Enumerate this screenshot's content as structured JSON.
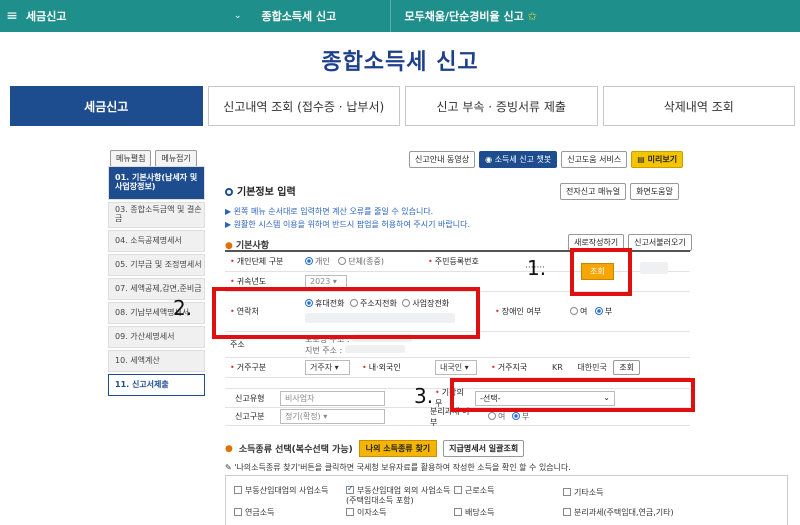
{
  "topnav": {
    "crumb1": "세금신고",
    "crumb2": "종합소득세 신고",
    "crumb3": "모두채움/단순경비율 신고"
  },
  "title": "종합소득세 신고",
  "tabs": [
    "세금신고",
    "신고내역 조회 (접수증 · 납부서)",
    "신고 부속 · 증빙서류 제출",
    "삭제내역 조회"
  ],
  "sidebar": {
    "expand": "메뉴펼침",
    "collapse": "메뉴접기",
    "items": [
      "01. 기본사항(납세자 및 사업장정보)",
      "03. 종합소득금액 및 결손금",
      "04. 소득공제명세서",
      "05. 기부금 및 조정명세서",
      "07. 세액공제,감면,준비금",
      "08. 기납부세액명세서",
      "09. 가산세명세서",
      "10. 세액계산",
      "11. 신고서제출"
    ]
  },
  "toolbar": {
    "video": "신고안내 동영상",
    "chatbot": "소득세 신고 챗봇",
    "help": "신고도움 서비스",
    "preview": "미리보기"
  },
  "section": {
    "title": "기본정보 입력",
    "manual": "전자신고 매뉴얼",
    "screen_help": "화면도움말",
    "note1": "▶ 왼쪽 메뉴 순서대로 입력하면 계산 오류를 줄일 수 있습니다.",
    "note2": "▶ 원활한 시스템 이용을 위하여 반드시 팝업을 허용하여 주시기 바랍니다."
  },
  "basic": {
    "title": "기본사항",
    "new_btn": "새로작성하기",
    "load_btn": "신고서불러오기",
    "type_label": "개인단체 구분",
    "type_opt1": "개인",
    "type_opt2": "단체(종중)",
    "rrn_label": "주민등록번호",
    "rrn_value": "·······",
    "lookup": "조회",
    "year_label": "귀속년도",
    "year_value": "2023",
    "contact_label": "연락처",
    "contact_opt1": "휴대전화",
    "contact_opt2": "주소지전화",
    "contact_opt3": "사업장전화",
    "disabled_label": "장애인 여부",
    "disabled_yes": "여",
    "disabled_no": "부",
    "address_label": "주소",
    "address_road": "도로명 주소 :",
    "address_lot": "지번 주소 :",
    "resident_label": "거주구분",
    "resident_value": "거주자",
    "nation_label": "내·외국인",
    "nation_value": "내국인",
    "region_label": "거주지국",
    "region_code": "KR",
    "region_name": "대한민국",
    "region_btn": "조회",
    "filing_type_label": "신고유형",
    "filing_type_value": "비사업자",
    "bookkeeping_label": "기장의무",
    "bookkeeping_value": "-선택-",
    "filing_class_label": "신고구분",
    "filing_class_value": "정기(확정)",
    "separate_label": "분리과세 여부",
    "separate_yes": "여",
    "separate_no": "부"
  },
  "annotations": [
    "1.",
    "2.",
    "3."
  ],
  "income": {
    "title": "소득종류 선택(복수선택 가능)",
    "find_btn": "나의 소득종류 찾기",
    "bulk_btn": "지급명세서 일괄조회",
    "note": "'나의소득종류 찾기'버튼을 클릭하면 국세청 보유자료를 활용하여 작성한 소득을 확인 할 수 있습니다.",
    "items": [
      "부동산임대업의 사업소득",
      "부동산임대업 외의 사업소득 (주택임대소득 포함)",
      "근로소득",
      "기타소득",
      "연금소득",
      "이자소득",
      "배당소득",
      "분리과세(주택임대,연금,기타)"
    ]
  },
  "colors": {
    "nav": "#1f8f8b",
    "primary": "#1d4d8f",
    "highlight": "#e01010"
  }
}
